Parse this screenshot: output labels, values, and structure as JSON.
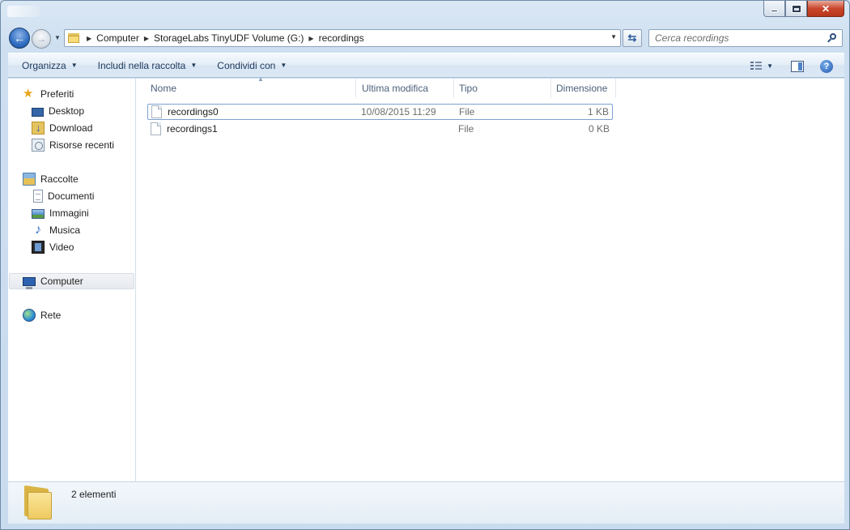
{
  "window": {
    "caption_buttons": {
      "close_glyph": "✕"
    }
  },
  "navigation": {
    "back_glyph": "←",
    "forward_glyph": "→",
    "breadcrumb": [
      "Computer",
      "StorageLabs TinyUDF Volume (G:)",
      "recordings"
    ],
    "search_placeholder": "Cerca recordings"
  },
  "toolbar": {
    "organize": "Organizza",
    "include_in_library": "Includi nella raccolta",
    "share_with": "Condividi con",
    "help_glyph": "?"
  },
  "sidebar": {
    "favorites": {
      "label": "Preferiti",
      "items": [
        "Desktop",
        "Download",
        "Risorse recenti"
      ]
    },
    "libraries": {
      "label": "Raccolte",
      "items": [
        "Documenti",
        "Immagini",
        "Musica",
        "Video"
      ]
    },
    "computer": "Computer",
    "network": "Rete"
  },
  "file_list": {
    "columns": [
      "Nome",
      "Ultima modifica",
      "Tipo",
      "Dimensione"
    ],
    "rows": [
      {
        "name": "recordings0",
        "modified": "10/08/2015 11:29",
        "type": "File",
        "size": "1 KB"
      },
      {
        "name": "recordings1",
        "modified": "",
        "type": "File",
        "size": "0 KB"
      }
    ]
  },
  "details": {
    "item_count": "2 elementi"
  },
  "colors": {
    "frame": "#cfdeee",
    "toolbar_text": "#1e395b",
    "header_text": "#4c607a",
    "secondary_text": "#6d6d6d"
  }
}
